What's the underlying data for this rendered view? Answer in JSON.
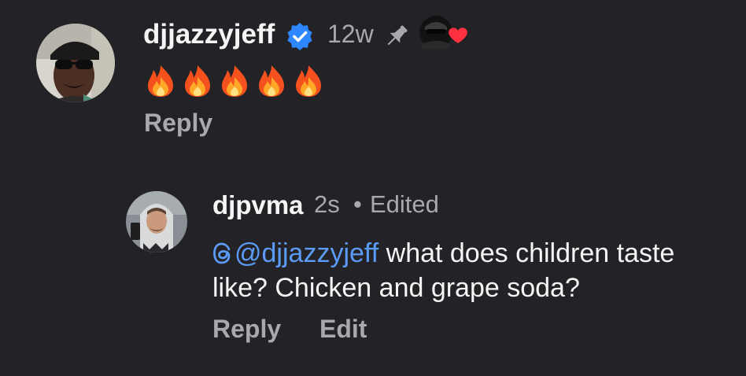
{
  "parent_comment": {
    "username": "djjazzyjeff",
    "time": "12w",
    "emojis": [
      "fire",
      "fire",
      "fire",
      "fire",
      "fire"
    ],
    "reply_label": "Reply"
  },
  "reply_comment": {
    "username": "djpvma",
    "time": "2s",
    "separator": "•",
    "edited_label": "Edited",
    "mention": "@djjazzyjeff",
    "text": " what does children taste like? Chicken and grape soda?",
    "reply_label": "Reply",
    "edit_label": "Edit"
  },
  "colors": {
    "background": "#232327",
    "mention": "#5b9bf5",
    "verified": "#2d88ff",
    "heart": "#ff3040",
    "muted": "#a8a8ad"
  }
}
